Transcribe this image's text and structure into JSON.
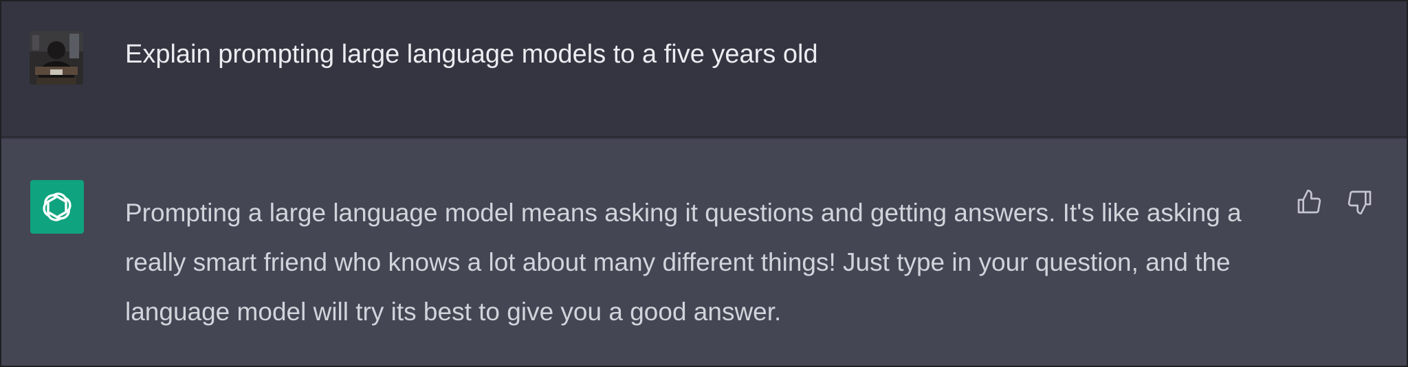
{
  "conversation": {
    "user_message": {
      "avatar": "user-photo-avatar",
      "text": "Explain prompting large language models to a five years old"
    },
    "assistant_message": {
      "avatar": "openai-logo-icon",
      "text": "Prompting a large language model means asking it questions and getting answers. It's like asking a really smart friend who knows a lot about many different things! Just type in your question, and the language model will try its best to give you a good answer.",
      "actions": [
        "thumbs-up-icon",
        "thumbs-down-icon"
      ]
    }
  },
  "colors": {
    "user_bg": "#343541",
    "assistant_bg": "#444654",
    "brand": "#10a37f",
    "text_primary": "#ececf1",
    "text_secondary": "#d1d5db",
    "icon": "#c5c5d2"
  }
}
